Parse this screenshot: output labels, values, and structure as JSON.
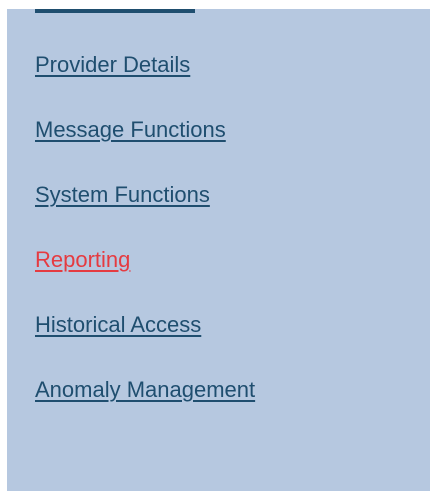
{
  "nav": {
    "items": [
      {
        "label": "Provider Details",
        "active": false
      },
      {
        "label": "Message Functions",
        "active": false
      },
      {
        "label": "System Functions",
        "active": false
      },
      {
        "label": "Reporting",
        "active": true
      },
      {
        "label": "Historical Access",
        "active": false
      },
      {
        "label": "Anomaly Management",
        "active": false
      }
    ]
  },
  "colors": {
    "panel_background": "#b6c8e0",
    "link": "#1f4e6f",
    "active_link": "#e53b41"
  }
}
